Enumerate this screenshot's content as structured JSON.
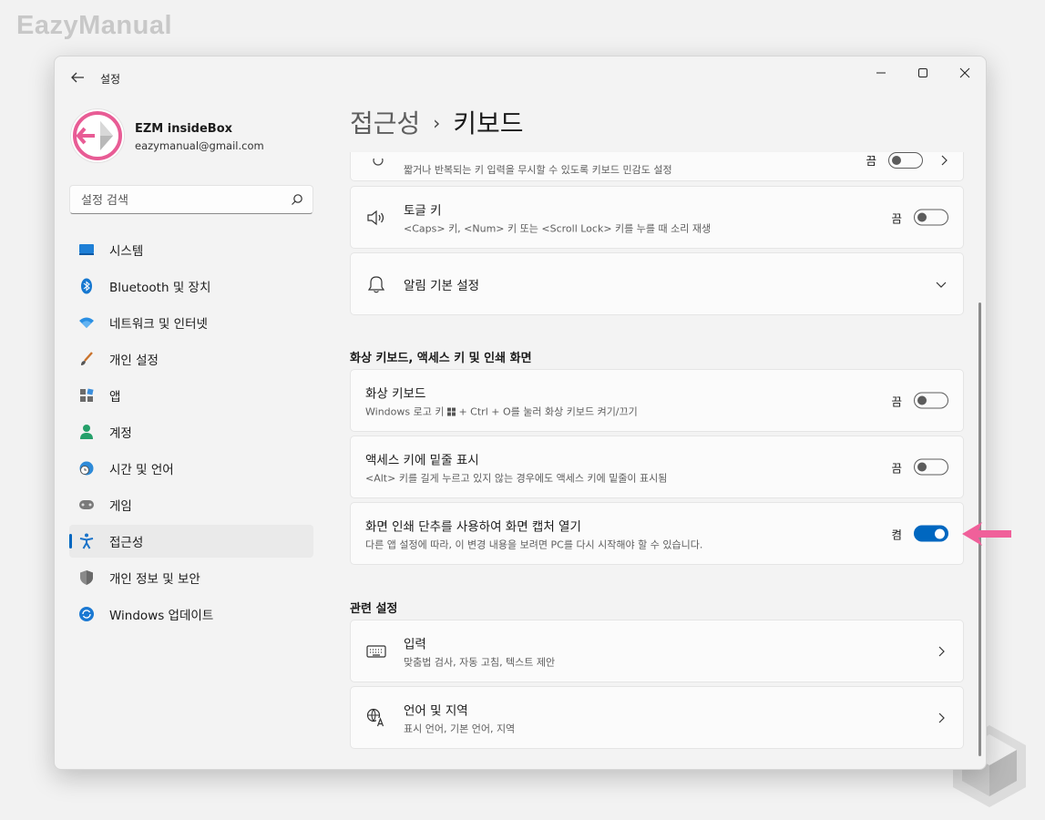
{
  "watermark": "EazyManual",
  "window": {
    "title": "설정",
    "controls": [
      "minimize-icon",
      "maximize-icon",
      "close-icon"
    ]
  },
  "profile": {
    "name": "EZM insideBox",
    "email": "eazymanual@gmail.com"
  },
  "search": {
    "placeholder": "설정 검색"
  },
  "nav": {
    "items": [
      {
        "label": "시스템",
        "icon": "system-icon"
      },
      {
        "label": "Bluetooth 및 장치",
        "icon": "bluetooth-icon"
      },
      {
        "label": "네트워크 및 인터넷",
        "icon": "wifi-icon"
      },
      {
        "label": "개인 설정",
        "icon": "brush-icon"
      },
      {
        "label": "앱",
        "icon": "apps-icon"
      },
      {
        "label": "계정",
        "icon": "person-icon"
      },
      {
        "label": "시간 및 언어",
        "icon": "globe-clock-icon"
      },
      {
        "label": "게임",
        "icon": "gamepad-icon"
      },
      {
        "label": "접근성",
        "icon": "accessibility-icon",
        "selected": true
      },
      {
        "label": "개인 정보 및 보안",
        "icon": "shield-icon"
      },
      {
        "label": "Windows 업데이트",
        "icon": "update-icon"
      }
    ]
  },
  "header": {
    "parent": "접근성",
    "separator": "›",
    "current": "키보드"
  },
  "cards": {
    "filter_keys": {
      "desc": "짧거나 반복되는 키 입력을 무시할 수 있도록 키보드 민감도 설정",
      "state": "끔"
    },
    "toggle_keys": {
      "title": "토글 키",
      "desc": "<Caps> 키, <Num> 키 또는 <Scroll Lock> 키를 누를 때 소리 재생",
      "state": "끔"
    },
    "notifications": {
      "title": "알림 기본 설정"
    },
    "osk_section": "화상 키보드, 액세스 키 및 인쇄 화면",
    "osk": {
      "title": "화상 키보드",
      "desc_pre": "Windows 로고 키",
      "desc_post": "+ Ctrl + O를 눌러 화상 키보드 켜기/끄기",
      "state": "끔"
    },
    "underline": {
      "title": "액세스 키에 밑줄 표시",
      "desc": "<Alt> 키를 길게 누르고 있지 않는 경우에도 액세스 키에 밑줄이 표시됨",
      "state": "끔"
    },
    "print_screen": {
      "title": "화면 인쇄 단추를 사용하여 화면 캡처 열기",
      "desc": "다른 앱 설정에 따라, 이 변경 내용을 보려면 PC를 다시 시작해야 할 수 있습니다.",
      "state": "켬"
    },
    "related_section": "관련 설정",
    "typing": {
      "title": "입력",
      "desc": "맞춤법 검사, 자동 고침, 텍스트 제안"
    },
    "language": {
      "title": "언어 및 지역",
      "desc": "표시 언어, 기본 언어, 지역"
    }
  },
  "colors": {
    "accent": "#0067c0",
    "arrow": "#f0609a",
    "selected_bg": "#eaeaea"
  }
}
